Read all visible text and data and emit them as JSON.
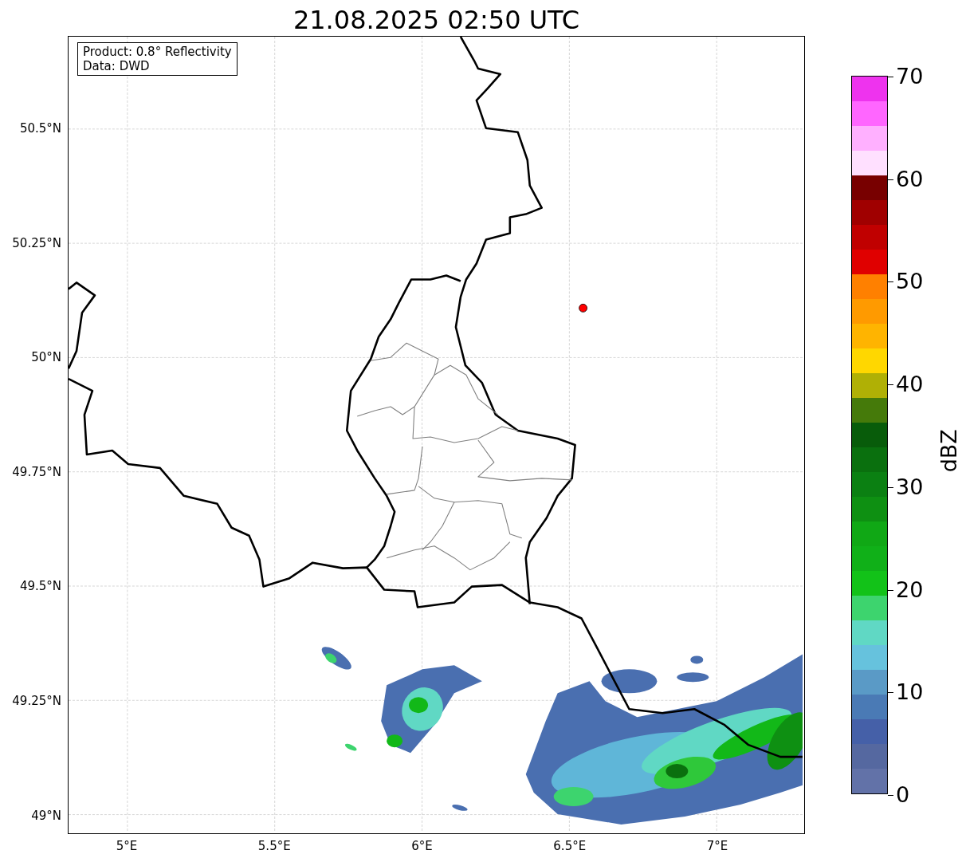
{
  "title": "21.08.2025 02:50 UTC",
  "info_box": [
    "Product: 0.8° Reflectivity",
    "Data: DWD"
  ],
  "y_labels": [
    "50.5°N",
    "50.25°N",
    "50°N",
    "49.75°N",
    "49.5°N",
    "49.25°N",
    "49°N"
  ],
  "x_labels": [
    "5°E",
    "5.5°E",
    "6°E",
    "6.5°E",
    "7°E"
  ],
  "colorbar": {
    "label": "dBZ",
    "ticks": [
      "70",
      "60",
      "50",
      "40",
      "30",
      "20",
      "10",
      "0"
    ],
    "segments": [
      {
        "color": "#ee33ee"
      },
      {
        "color": "#ff66ff"
      },
      {
        "color": "#ffb0ff"
      },
      {
        "color": "#ffe0ff"
      },
      {
        "color": "#780000"
      },
      {
        "color": "#a00000"
      },
      {
        "color": "#c00000"
      },
      {
        "color": "#e00000"
      },
      {
        "color": "#ff8000"
      },
      {
        "color": "#ff9a00"
      },
      {
        "color": "#ffb400"
      },
      {
        "color": "#ffd700"
      },
      {
        "color": "#b0b005"
      },
      {
        "color": "#457a0a"
      },
      {
        "color": "#085c0a"
      },
      {
        "color": "#0a700e"
      },
      {
        "color": "#0b8012"
      },
      {
        "color": "#0e9012"
      },
      {
        "color": "#10a815"
      },
      {
        "color": "#10b018"
      },
      {
        "color": "#12c218"
      },
      {
        "color": "#3dd46e"
      },
      {
        "color": "#60d8c4"
      },
      {
        "color": "#66c2dd"
      },
      {
        "color": "#5a9ac6"
      },
      {
        "color": "#4a7ab5"
      },
      {
        "color": "#4560a8"
      },
      {
        "color": "#5568a0"
      },
      {
        "color": "#6272a8"
      }
    ]
  }
}
